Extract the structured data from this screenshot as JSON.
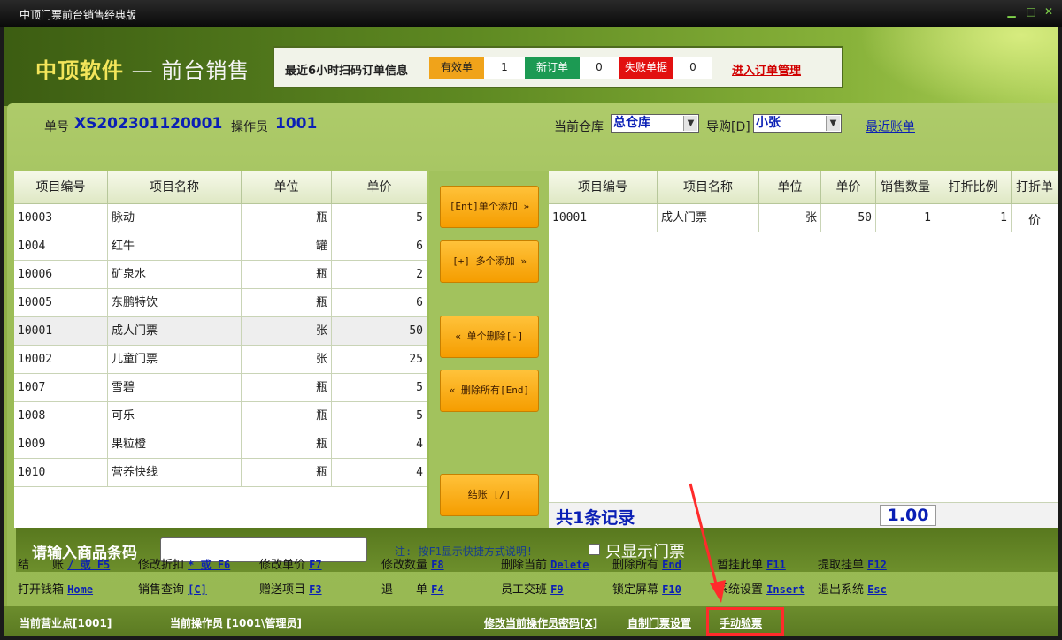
{
  "window": {
    "title": "中顶门票前台销售经典版",
    "min": "▁",
    "max": "□",
    "close": "✕"
  },
  "header": {
    "brand_left": "中顶软件",
    "brand_dash": "—",
    "brand_right": "前台销售",
    "scan_label": "最近6小时扫码订单信息",
    "valid_label": "有效单",
    "valid_count": "1",
    "new_label": "新订单",
    "new_count": "0",
    "fail_label": "失败单据",
    "fail_count": "0",
    "manage_link": "进入订单管理"
  },
  "order": {
    "no_label": "单号",
    "no_value": "XS202301120001",
    "op_label": "操作员",
    "op_value": "1001",
    "warehouse_label": "当前仓库",
    "warehouse_value": "总仓库",
    "guide_label": "导购[D]",
    "guide_value": "小张",
    "recent_link": "最近账单"
  },
  "left_table": {
    "headers": [
      "项目编号",
      "项目名称",
      "单位",
      "单价"
    ],
    "rows": [
      [
        "10003",
        "脉动",
        "瓶",
        "5"
      ],
      [
        "1004",
        "红牛",
        "罐",
        "6"
      ],
      [
        "10006",
        "矿泉水",
        "瓶",
        "2"
      ],
      [
        "10005",
        "东鹏特饮",
        "瓶",
        "6"
      ],
      [
        "10001",
        "成人门票",
        "张",
        "50"
      ],
      [
        "10002",
        "儿童门票",
        "张",
        "25"
      ],
      [
        "1007",
        "雪碧",
        "瓶",
        "5"
      ],
      [
        "1008",
        "可乐",
        "瓶",
        "5"
      ],
      [
        "1009",
        "果粒橙",
        "瓶",
        "4"
      ],
      [
        "1010",
        "营养快线",
        "瓶",
        "4"
      ]
    ]
  },
  "buttons": {
    "add_one": "[Ent]单个添加 »",
    "add_many": "[+] 多个添加 »",
    "del_one": "« 单个删除[-]",
    "del_all": "« 删除所有[End]",
    "checkout": "结账 [/]"
  },
  "right_table": {
    "headers": [
      "项目编号",
      "项目名称",
      "单位",
      "单价",
      "销售数量",
      "打折比例",
      "打折单价"
    ],
    "rows": [
      [
        "10001",
        "成人门票",
        "张",
        "50",
        "1",
        "1",
        ""
      ]
    ],
    "total_count": "共1条记录",
    "total_amount": "1.00"
  },
  "barcode": {
    "label": "请输入商品条码",
    "value": "",
    "note": "注: 按F1显示快捷方式说明!",
    "only_tickets": "只显示门票"
  },
  "shortcuts": {
    "row1": [
      {
        "label": "结　　账",
        "key": "/ 或 F5"
      },
      {
        "label": "修改折扣",
        "key": "* 或 F6"
      },
      {
        "label": "修改单价",
        "key": "F7"
      },
      {
        "label": "修改数量",
        "key": "F8"
      },
      {
        "label": "删除当前",
        "key": "Delete"
      },
      {
        "label": "删除所有",
        "key": "End"
      },
      {
        "label": "暂挂此单",
        "key": "F11"
      },
      {
        "label": "提取挂单",
        "key": "F12"
      }
    ],
    "row2": [
      {
        "label": "打开钱箱",
        "key": "Home"
      },
      {
        "label": "销售查询",
        "key": "[C]"
      },
      {
        "label": "赠送项目",
        "key": "F3"
      },
      {
        "label": "退　　单",
        "key": "F4"
      },
      {
        "label": "员工交班",
        "key": "F9"
      },
      {
        "label": "锁定屏幕",
        "key": "F10"
      },
      {
        "label": "系统设置",
        "key": "Insert"
      },
      {
        "label": "退出系统",
        "key": "Esc"
      }
    ]
  },
  "footer": {
    "business_point": "当前营业点[1001]",
    "operator": "当前操作员 [1001\\管理员]",
    "change_pwd": "修改当前操作员密码[X]",
    "custom_ticket": "自制门票设置",
    "manual_check": "手动验票",
    "highlight_color": "#ff2b2b"
  }
}
